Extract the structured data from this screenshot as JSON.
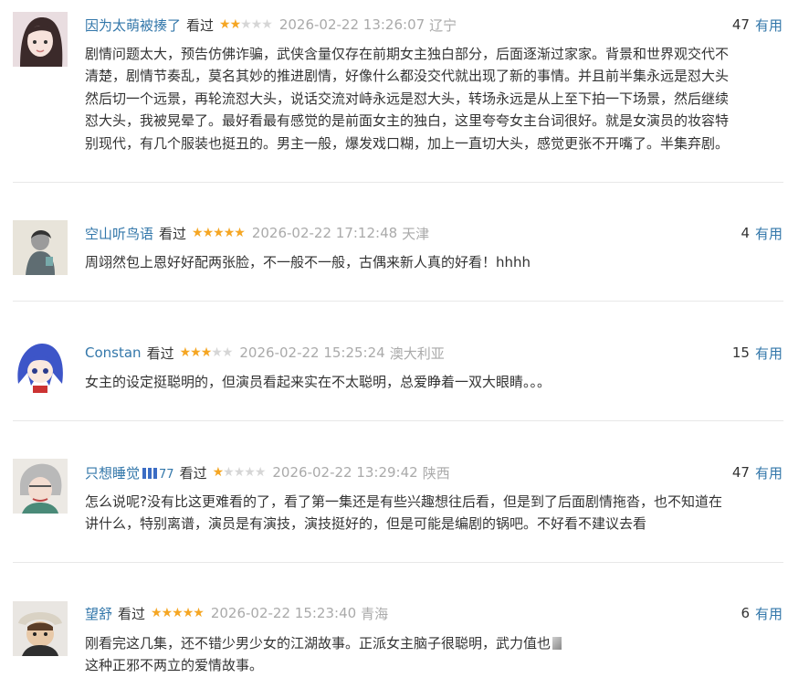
{
  "reviews": [
    {
      "user": "因为太萌被揍了",
      "badge": "",
      "status": "看过",
      "rating": 2,
      "time": "2026-02-22 13:26:07",
      "location": "辽宁",
      "votes": "47",
      "useful_label": "有用",
      "avatar_icon": "anime-girl-avatar-icon",
      "lines": [
        "剧情问题太大，预告仿佛诈骗，武侠含量仅存在前期女主独白部分，后面逐渐过家家。背景和世界观交代不",
        "清楚，剧情节奏乱，莫名其妙的推进剧情，好像什么都没交代就出现了新的事情。并且前半集永远是怼大头",
        "然后切一个远景，再轮流怼大头，说话交流对峙永远是怼大头，转场永远是从上至下拍一下场景，然后继续",
        "怼大头，我被晃晕了。最好看最有感觉的是前面女主的独白，这里夸夸女主台词很好。就是女演员的妆容特",
        "别现代，有几个服装也挺丑的。男主一般，爆发戏口糊，加上一直切大头，感觉更张不开嘴了。半集弃剧。"
      ]
    },
    {
      "user": "空山听鸟语",
      "badge": "",
      "status": "看过",
      "rating": 5,
      "time": "2026-02-22 17:12:48",
      "location": "天津",
      "votes": "4",
      "useful_label": "有用",
      "avatar_icon": "sketch-figure-avatar-icon",
      "lines": [
        "周翊然包上恩好好配两张脸，不一般不一般，古偶来新人真的好看！hhhh"
      ]
    },
    {
      "user": "Constan",
      "badge": "",
      "status": "看过",
      "rating": 3,
      "time": "2026-02-22 15:25:24",
      "location": "澳大利亚",
      "votes": "15",
      "useful_label": "有用",
      "avatar_icon": "blue-hair-anime-avatar-icon",
      "lines": [
        "女主的设定挺聪明的，但演员看起来实在不太聪明，总爱睁着一双大眼睛。。。"
      ]
    },
    {
      "user": "只想睡觉",
      "badge": "77",
      "status": "看过",
      "rating": 1,
      "time": "2026-02-22 13:29:42",
      "location": "陕西",
      "votes": "47",
      "useful_label": "有用",
      "avatar_icon": "sketch-character-avatar-icon",
      "lines": [
        "怎么说呢?没有比这更难看的了，看了第一集还是有些兴趣想往后看，但是到了后面剧情拖沓，也不知道在",
        "讲什么，特别离谱，演员是有演技，演技挺好的，但是可能是编剧的锅吧。不好看不建议去看"
      ]
    },
    {
      "user": "望舒",
      "badge": "",
      "status": "看过",
      "rating": 5,
      "time": "2026-02-22 15:23:40",
      "location": "青海",
      "votes": "6",
      "useful_label": "有用",
      "avatar_icon": "pirate-character-avatar-icon",
      "lines": [
        "刚看完这几集，还不错少男少女的江湖故事。正派女主脑子很聪明，武力值也",
        "这种正邪不两立的爱情故事。"
      ]
    }
  ],
  "colors": {
    "link": "#3377aa",
    "star_on": "#f5a623",
    "star_off": "#d6d6d6",
    "meta": "#aaaaaa",
    "text": "#333333",
    "divider": "#e8e8e8"
  }
}
